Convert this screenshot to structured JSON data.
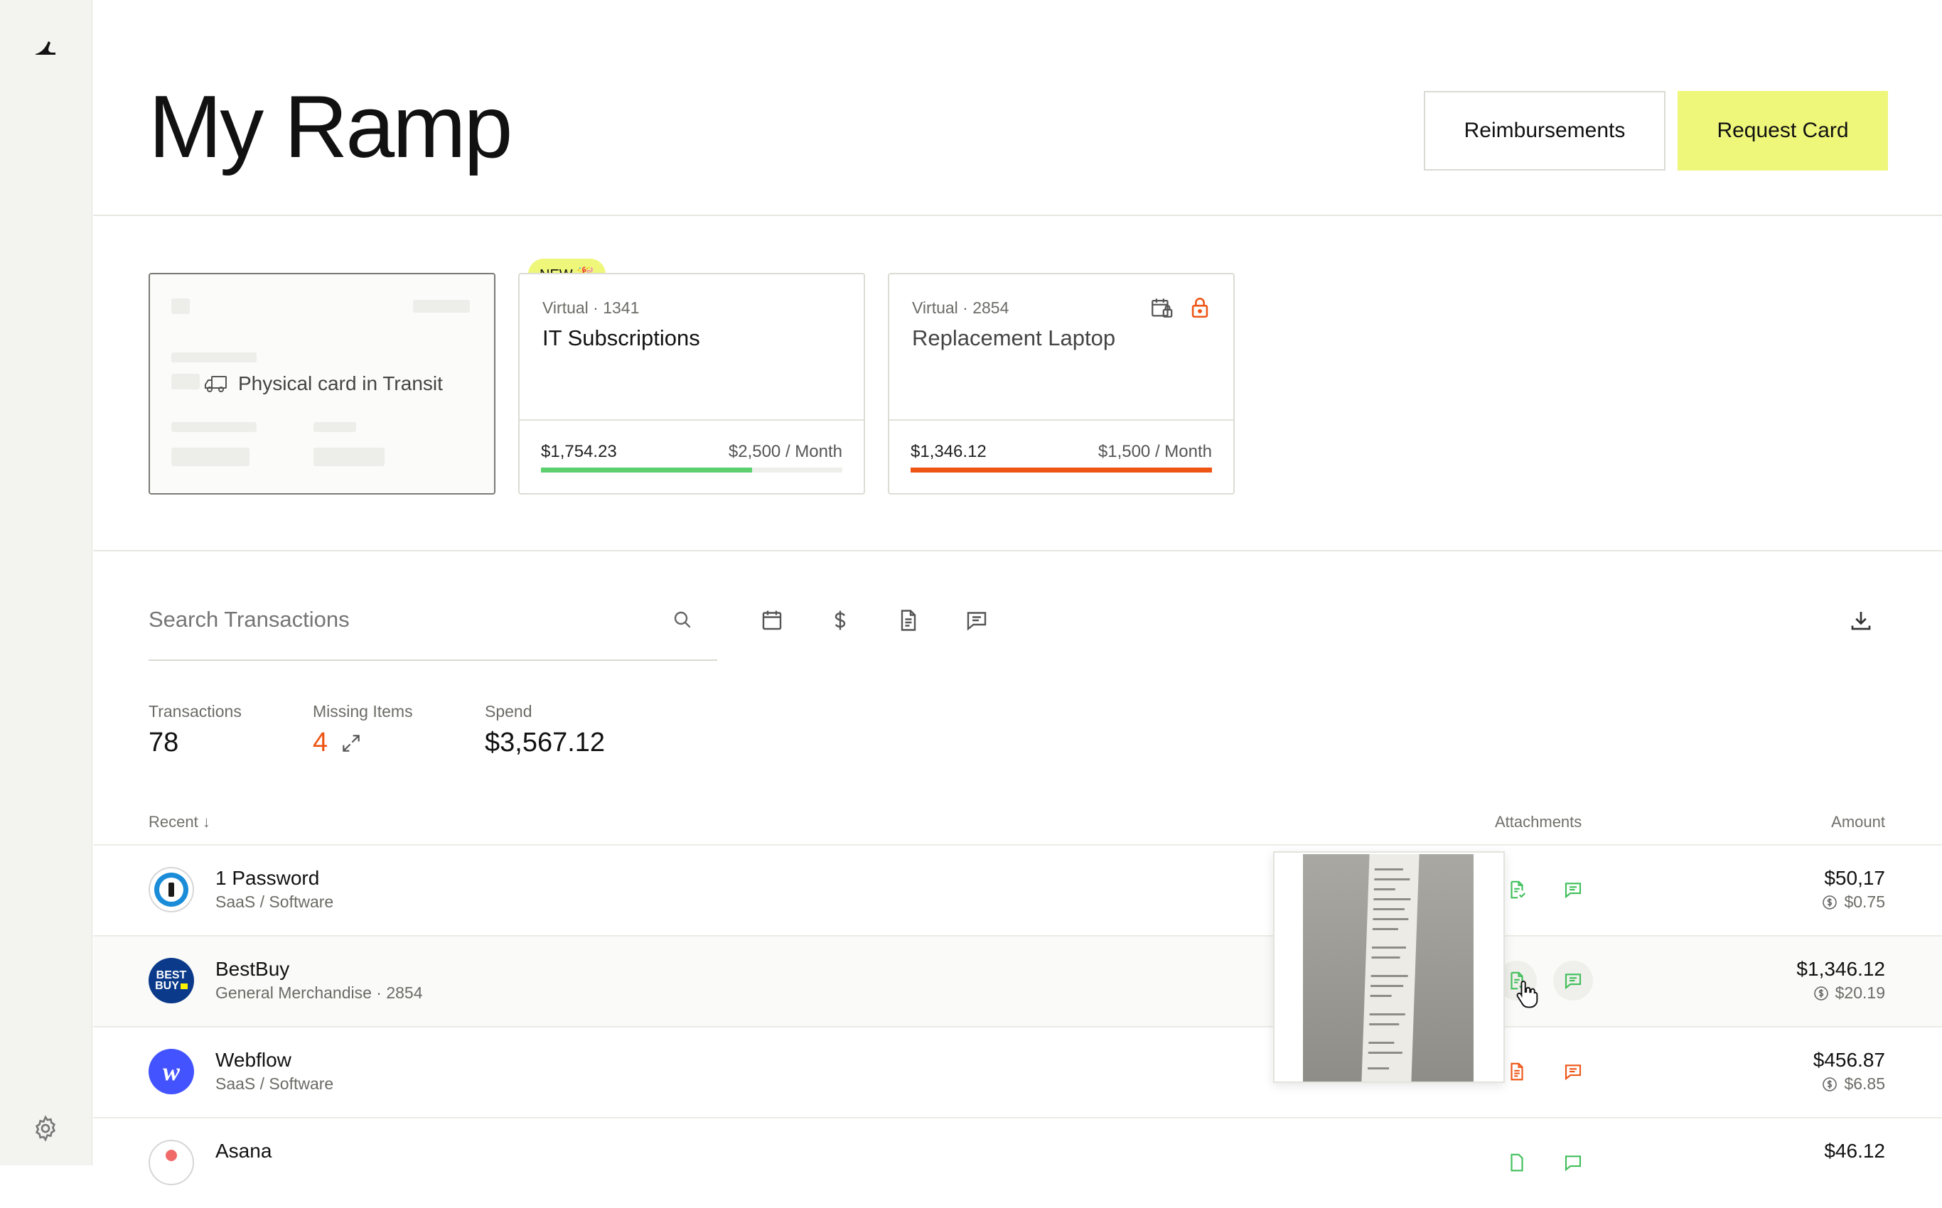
{
  "header": {
    "title": "My Ramp",
    "reimbursements_label": "Reimbursements",
    "request_card_label": "Request Card"
  },
  "cards": [
    {
      "badge": "NEW 🎉",
      "status": "Physical card in Transit"
    },
    {
      "sub": "Virtual · 1341",
      "name": "IT Subscriptions",
      "spent": "$1,754.23",
      "limit": "$2,500 / Month",
      "progress": 0.7,
      "color": "#5ccf6e"
    },
    {
      "sub": "Virtual · 2854",
      "name": "Replacement Laptop",
      "spent": "$1,346.12",
      "limit": "$1,500 / Month",
      "progress": 1.0,
      "color": "#ee5515"
    }
  ],
  "search": {
    "placeholder": "Search Transactions"
  },
  "stats": {
    "transactions_label": "Transactions",
    "transactions_value": "78",
    "missing_label": "Missing Items",
    "missing_value": "4",
    "spend_label": "Spend",
    "spend_value": "$3,567.12"
  },
  "table": {
    "recent_label": "Recent ↓",
    "attachments_label": "Attachments",
    "amount_label": "Amount",
    "rows": [
      {
        "merchant": "1 Password",
        "category": "SaaS / Software",
        "amount": "$50,17",
        "cashback": "$0.75"
      },
      {
        "merchant": "BestBuy",
        "category": "General Merchandise · 2854",
        "amount": "$1,346.12",
        "cashback": "$20.19"
      },
      {
        "merchant": "Webflow",
        "category": "SaaS / Software",
        "amount": "$456.87",
        "cashback": "$6.85"
      },
      {
        "merchant": "Asana",
        "category": "",
        "amount": "$46.12",
        "cashback": ""
      }
    ]
  },
  "colors": {
    "accent": "#eef77a",
    "green": "#3fbf5a",
    "orange": "#ee5515"
  },
  "icons": [
    "ramp-logo-icon",
    "gear-icon",
    "truck-icon",
    "calendar-lock-icon",
    "lock-icon",
    "search-icon",
    "calendar-icon",
    "dollar-icon",
    "document-icon",
    "comment-icon",
    "download-icon",
    "expand-icon",
    "cashback-icon"
  ]
}
